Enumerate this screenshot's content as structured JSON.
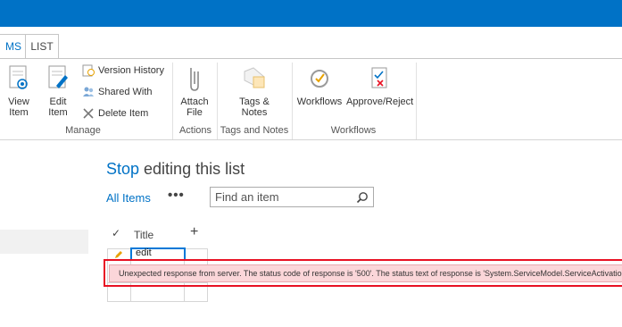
{
  "ribbon": {
    "tabs": [
      {
        "label": "MS"
      },
      {
        "label": "LIST"
      }
    ],
    "groups": {
      "manage": {
        "label": "Manage",
        "view_item": "View\nItem",
        "edit_item": "Edit\nItem",
        "version_history": "Version History",
        "shared_with": "Shared With",
        "delete_item": "Delete Item"
      },
      "actions": {
        "label": "Actions",
        "attach_file": "Attach\nFile"
      },
      "tags": {
        "label": "Tags and Notes",
        "tags_notes": "Tags &\nNotes"
      },
      "workflows": {
        "label": "Workflows",
        "workflows": "Workflows",
        "approve_reject": "Approve/Reject"
      }
    }
  },
  "page": {
    "heading_stop": "Stop",
    "heading_rest": " editing this list",
    "view_label": "All Items",
    "more_label": "•••",
    "search_placeholder": "Find an item"
  },
  "list": {
    "check_col": "✓",
    "title_col": "Title",
    "add_col": "+",
    "edit_cell_value": "edit"
  },
  "error": {
    "message": "Unexpected response from server. The status code of response is '500'. The status text of response is 'System.ServiceModel.ServiceActivationExce"
  },
  "colors": {
    "suite_bar": "#0072c6",
    "accent": "#0072c6",
    "error_border": "#e81123",
    "error_fill": "#fbd6d9"
  }
}
